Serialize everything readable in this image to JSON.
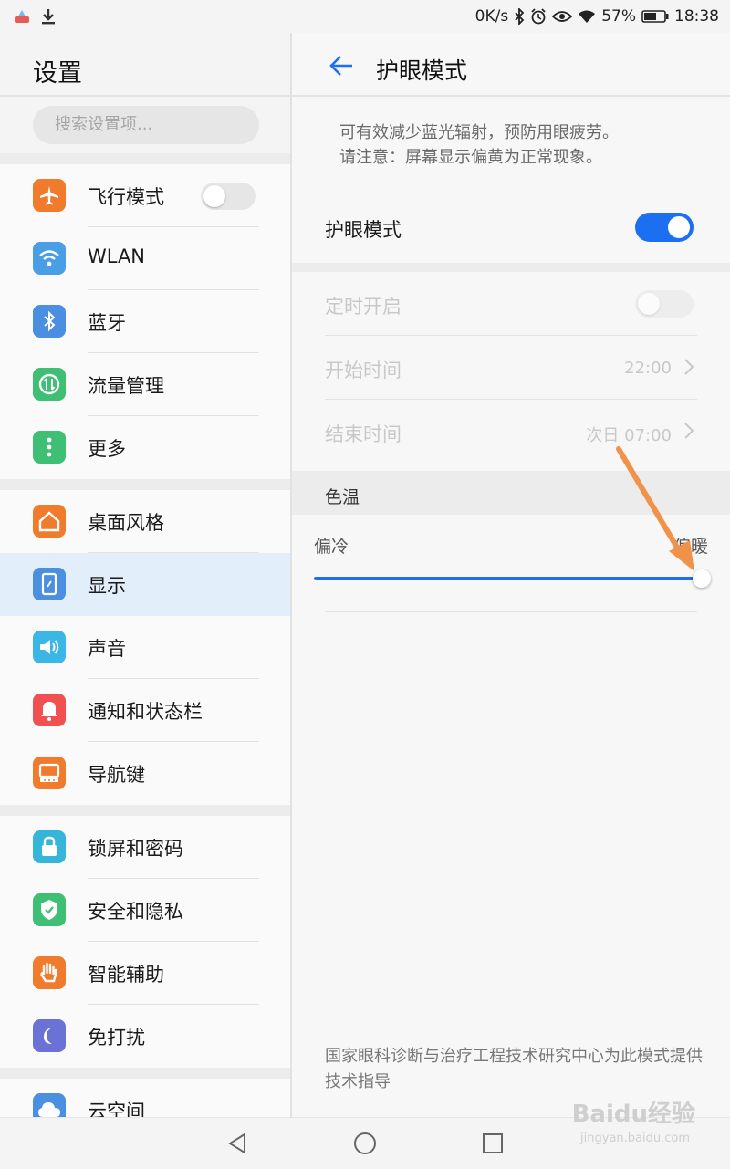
{
  "status_bar": {
    "net_speed": "0K/s",
    "battery": "57%",
    "time": "18:38"
  },
  "left": {
    "title": "设置",
    "search_placeholder": "搜索设置项...",
    "groups": [
      [
        {
          "label": "飞行模式",
          "icon": "airplane-icon",
          "color": "#f07b2d",
          "toggle": "off"
        },
        {
          "label": "WLAN",
          "icon": "wifi-icon",
          "color": "#4a9ee6"
        },
        {
          "label": "蓝牙",
          "icon": "bluetooth-icon",
          "color": "#4a8fe0"
        },
        {
          "label": "流量管理",
          "icon": "data-usage-icon",
          "color": "#3fbf73"
        },
        {
          "label": "更多",
          "icon": "more-icon",
          "color": "#3fbf73"
        }
      ],
      [
        {
          "label": "桌面风格",
          "icon": "home-icon",
          "color": "#f07b2d"
        },
        {
          "label": "显示",
          "icon": "display-icon",
          "color": "#4a8fe0",
          "selected": true
        },
        {
          "label": "声音",
          "icon": "sound-icon",
          "color": "#3ab7e6"
        },
        {
          "label": "通知和状态栏",
          "icon": "bell-icon",
          "color": "#f05050"
        },
        {
          "label": "导航键",
          "icon": "navigation-key-icon",
          "color": "#f07b2d"
        }
      ],
      [
        {
          "label": "锁屏和密码",
          "icon": "lock-icon",
          "color": "#35b6d8"
        },
        {
          "label": "安全和隐私",
          "icon": "shield-icon",
          "color": "#3fbf73"
        },
        {
          "label": "智能辅助",
          "icon": "hand-icon",
          "color": "#f07b2d"
        },
        {
          "label": "免打扰",
          "icon": "moon-icon",
          "color": "#6a72d6"
        }
      ],
      [
        {
          "label": "云空间",
          "icon": "cloud-icon",
          "color": "#4a8fe0"
        }
      ]
    ]
  },
  "right": {
    "title": "护眼模式",
    "description_line1": "可有效减少蓝光辐射，预防用眼疲劳。",
    "description_line2": "请注意：屏幕显示偏黄为正常现象。",
    "eye_mode_label": "护眼模式",
    "eye_mode_on": true,
    "schedule_label": "定时开启",
    "start_label": "开始时间",
    "start_value": "22:00",
    "end_label": "结束时间",
    "end_value": "次日 07:00",
    "color_temp_header": "色温",
    "cold_label": "偏冷",
    "warm_label": "偏暖",
    "color_temp_level": 1.0,
    "footer_note": "国家眼科诊断与治疗工程技术研究中心为此模式提供技术指导"
  },
  "watermark": {
    "text": "Baidu经验",
    "sub": "jingyan.baidu.com"
  },
  "colors": {
    "accent": "#1d6ff2",
    "annotation_arrow": "#f0924a",
    "selected_row": "#e2eefa"
  }
}
